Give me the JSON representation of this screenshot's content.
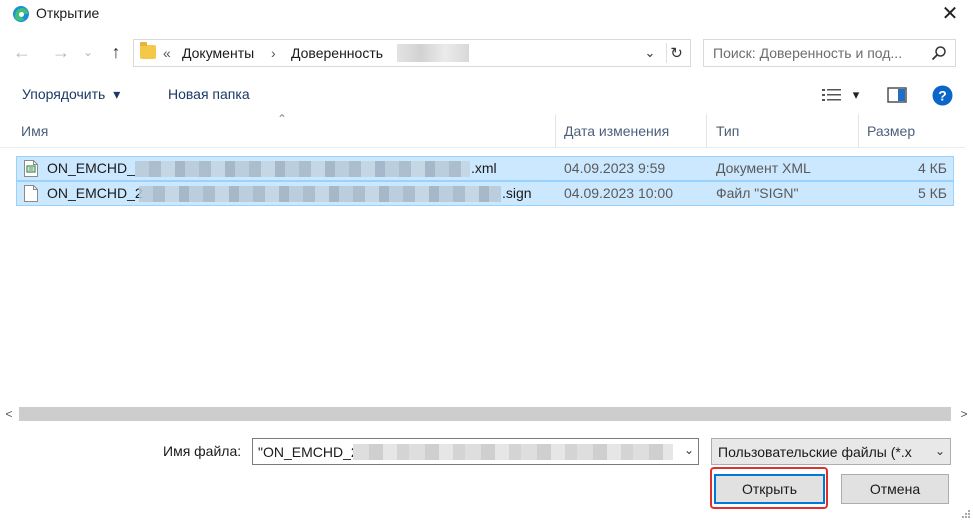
{
  "window": {
    "title": "Открытие",
    "close_glyph": "✕"
  },
  "nav": {
    "back_glyph": "←",
    "forward_glyph": "→",
    "recent_glyph": "⌄",
    "up_glyph": "↑",
    "breadcrumb_overflow": "«",
    "breadcrumb": [
      "Документы",
      "Доверенность"
    ],
    "breadcrumb_sep": "›",
    "address_dropdown_glyph": "⌄",
    "refresh_glyph": "↻"
  },
  "search": {
    "placeholder": "Поиск: Доверенность и под..."
  },
  "toolbar": {
    "organize_label": "Упорядочить",
    "organize_caret": "▾",
    "new_folder_label": "Новая папка",
    "view_caret": "▾",
    "help_glyph": "?"
  },
  "columns": {
    "name": "Имя",
    "modified": "Дата изменения",
    "type": "Тип",
    "size": "Размер",
    "sort_glyph": "⌃"
  },
  "files": [
    {
      "name_prefix": "ON_EMCHD_",
      "name_suffix": ".xml",
      "modified": "04.09.2023 9:59",
      "type": "Документ XML",
      "size": "4 КБ",
      "icon": "xml-file-icon"
    },
    {
      "name_prefix": "ON_EMCHD_2",
      "name_suffix": ".sign",
      "modified": "04.09.2023 10:00",
      "type": "Файл \"SIGN\"",
      "size": "5 КБ",
      "icon": "generic-file-icon"
    }
  ],
  "scroll": {
    "left_glyph": "<",
    "right_glyph": ">"
  },
  "bottom": {
    "filename_label": "Имя файла:",
    "filename_value": "\"ON_EMCHD_2",
    "filename_dropdown_glyph": "⌄",
    "filter_value": "Пользовательские файлы (*.x",
    "filter_dropdown_glyph": "⌄",
    "open_label": "Открыть",
    "cancel_label": "Отмена"
  },
  "colors": {
    "selection_bg": "#cce8ff",
    "selection_border": "#99d1ff",
    "highlight_red": "#e0302f",
    "default_button_border": "#0078d7",
    "help_blue": "#0a66c8"
  }
}
